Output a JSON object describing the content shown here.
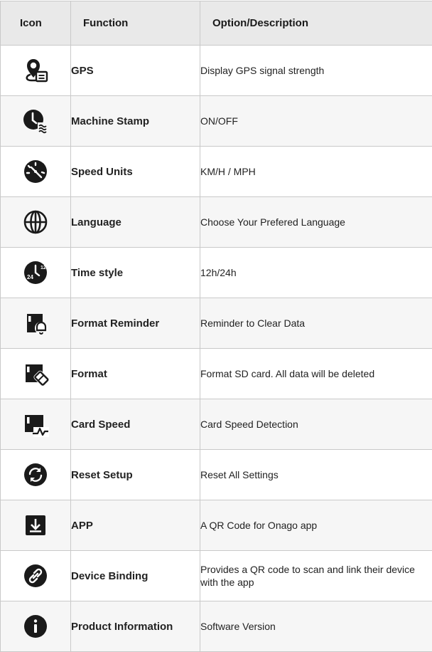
{
  "header": {
    "icon": "Icon",
    "function": "Function",
    "option": "Option/Description"
  },
  "rows": [
    {
      "icon": "gps-pin-icon",
      "function": "GPS",
      "option": "Display GPS signal strength"
    },
    {
      "icon": "clock-waves-icon",
      "function": "Machine Stamp",
      "option": "ON/OFF"
    },
    {
      "icon": "speedometer-icon",
      "function": "Speed Units",
      "option": "KM/H / MPH"
    },
    {
      "icon": "globe-icon",
      "function": "Language",
      "option": "Choose Your Prefered Language"
    },
    {
      "icon": "clock-24-icon",
      "function": "Time style",
      "option": "12h/24h"
    },
    {
      "icon": "sd-card-bell-icon",
      "function": "Format Reminder",
      "option": "Reminder to Clear Data"
    },
    {
      "icon": "sd-card-eraser-icon",
      "function": "Format",
      "option": "Format SD card. All data will be deleted"
    },
    {
      "icon": "sd-card-speed-icon",
      "function": "Card Speed",
      "option": "Card Speed Detection"
    },
    {
      "icon": "reset-arrows-icon",
      "function": "Reset Setup",
      "option": "Reset All Settings"
    },
    {
      "icon": "download-icon",
      "function": "APP",
      "option": "A QR Code for Onago app"
    },
    {
      "icon": "link-icon",
      "function": "Device Binding",
      "option": "Provides a QR code to scan and link their device with the app"
    },
    {
      "icon": "info-icon",
      "function": "Product Information",
      "option": "Software Version"
    }
  ],
  "icon_labels": {
    "clock_24_small": "12",
    "clock_24_big": "24"
  }
}
